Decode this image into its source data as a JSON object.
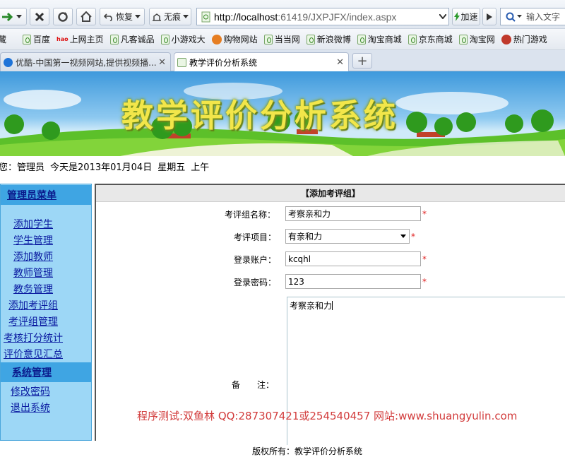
{
  "browser": {
    "toolbar": {
      "restore_label": "恢复",
      "traceless_label": "无痕",
      "url_host": "http://localhost",
      "url_rest": ":61419/JXPJFX/index.aspx",
      "accelerate_label": "加速",
      "search_placeholder": "输入文字"
    },
    "favorites": [
      {
        "label": "藏",
        "icon": "none"
      },
      {
        "label": "百度",
        "icon": "page-icon"
      },
      {
        "label": "上网主页",
        "icon": "hao-icon"
      },
      {
        "label": "凡客诚品",
        "icon": "page-icon"
      },
      {
        "label": "小游戏大",
        "icon": "page-icon"
      },
      {
        "label": "购物网站",
        "icon": "shop-icon"
      },
      {
        "label": "当当网",
        "icon": "page-icon"
      },
      {
        "label": "新浪微博",
        "icon": "page-icon"
      },
      {
        "label": "淘宝商城",
        "icon": "page-icon"
      },
      {
        "label": "京东商城",
        "icon": "page-icon"
      },
      {
        "label": "淘宝网",
        "icon": "page-icon"
      },
      {
        "label": "热门游戏",
        "icon": "game-icon"
      }
    ],
    "tabs": [
      {
        "title": "优酷-中国第一视频网站,提供视频播...",
        "active": false
      },
      {
        "title": "教学评价分析系统",
        "active": true
      }
    ]
  },
  "banner": {
    "title": "教学评价分析系统"
  },
  "greeting": {
    "prefix": "您：",
    "user": "管理员",
    "date_text": "今天是2013年01月04日",
    "weekday": "星期五",
    "period": "上午"
  },
  "sidebar": {
    "admin_header": "管理员菜单",
    "admin_items": [
      "添加学生",
      "学生管理",
      "添加教师",
      "教师管理",
      "教务管理",
      "添加考评组",
      "考评组管理",
      "考核打分统计",
      "评价意见汇总"
    ],
    "system_header": "系统管理",
    "system_items": [
      "修改密码",
      "退出系统"
    ]
  },
  "form": {
    "title": "【添加考评组】",
    "name_label": "考评组名称：",
    "name_value": "考察亲和力",
    "project_label": "考评项目：",
    "project_value": "有亲和力",
    "account_label": "登录账户：",
    "account_value": "kcqhl",
    "password_label": "登录密码：",
    "password_value": "123",
    "remark_label": "备　　注：",
    "remark_value": "考察亲和力",
    "required_mark": "*"
  },
  "watermark": "程序测试:双鱼林 QQ:287307421或254540457 网站:www.shuangyulin.com",
  "footer": "版权所有：教学评价分析系统",
  "colors": {
    "sidebar_bg": "#9dd7f6",
    "menu_header_bg": "#3fa5e3",
    "link": "#0a1aa0",
    "required": "#e02020",
    "watermark": "#d23c3c",
    "banner_title": "#f2e64a"
  }
}
